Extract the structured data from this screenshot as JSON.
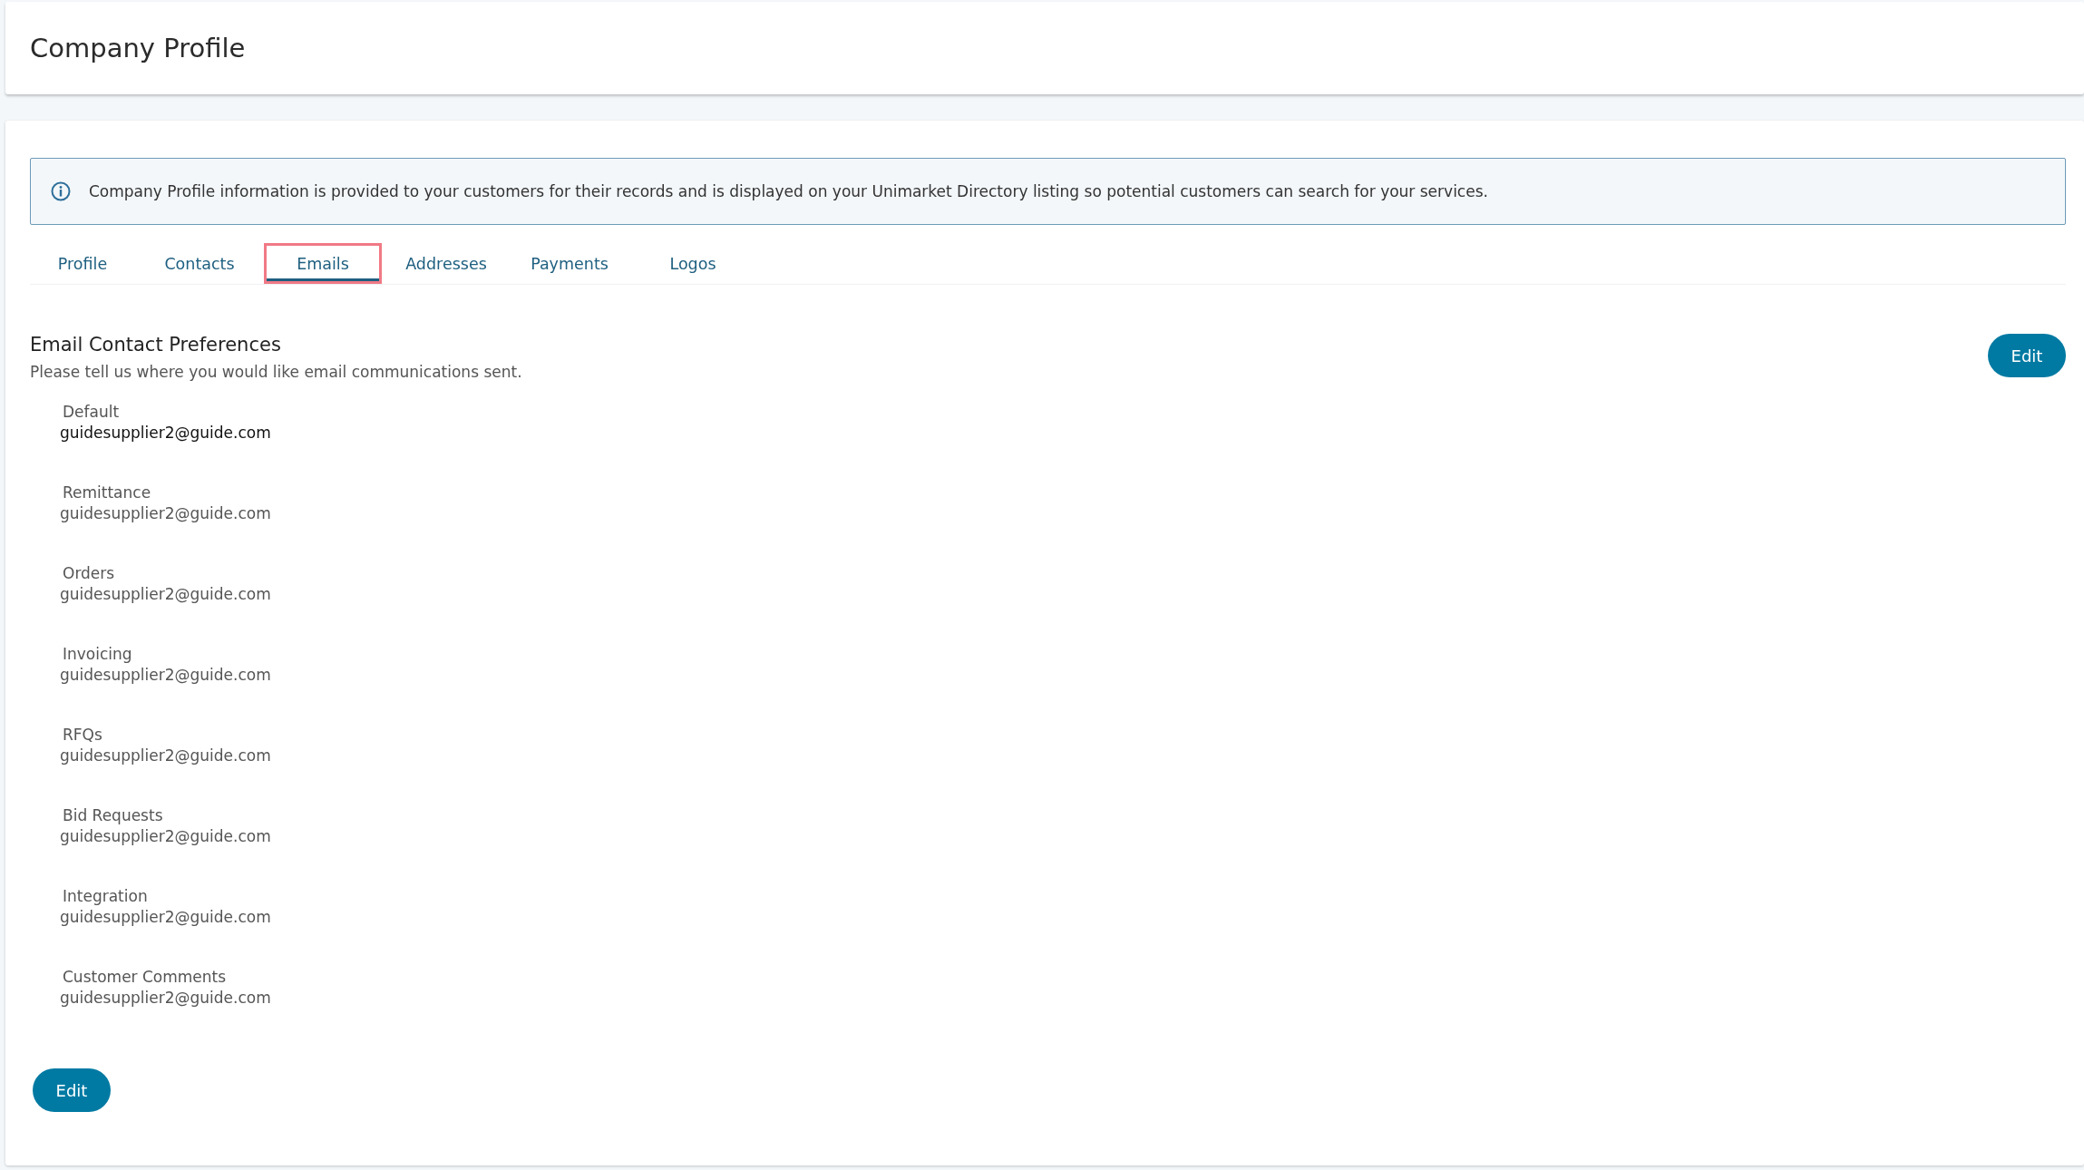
{
  "page": {
    "title": "Company Profile"
  },
  "info_banner": {
    "text": "Company Profile information is provided to your customers for their records and is displayed on your Unimarket Directory listing so potential customers can search for your services."
  },
  "tabs": [
    {
      "label": "Profile",
      "selected": false,
      "highlighted": false
    },
    {
      "label": "Contacts",
      "selected": false,
      "highlighted": false
    },
    {
      "label": "Emails",
      "selected": true,
      "highlighted": true
    },
    {
      "label": "Addresses",
      "selected": false,
      "highlighted": false
    },
    {
      "label": "Payments",
      "selected": false,
      "highlighted": false
    },
    {
      "label": "Logos",
      "selected": false,
      "highlighted": false
    }
  ],
  "section": {
    "title": "Email Contact Preferences",
    "subtitle": "Please tell us where you would like email communications sent.",
    "edit_button": "Edit"
  },
  "emails": [
    {
      "label": "Default",
      "value": "guidesupplier2@guide.com",
      "primary": true
    },
    {
      "label": "Remittance",
      "value": "guidesupplier2@guide.com",
      "primary": false
    },
    {
      "label": "Orders",
      "value": "guidesupplier2@guide.com",
      "primary": false
    },
    {
      "label": "Invoicing",
      "value": "guidesupplier2@guide.com",
      "primary": false
    },
    {
      "label": "RFQs",
      "value": "guidesupplier2@guide.com",
      "primary": false
    },
    {
      "label": "Bid Requests",
      "value": "guidesupplier2@guide.com",
      "primary": false
    },
    {
      "label": "Integration",
      "value": "guidesupplier2@guide.com",
      "primary": false
    },
    {
      "label": "Customer Comments",
      "value": "guidesupplier2@guide.com",
      "primary": false
    }
  ],
  "bottom_button": "Edit"
}
